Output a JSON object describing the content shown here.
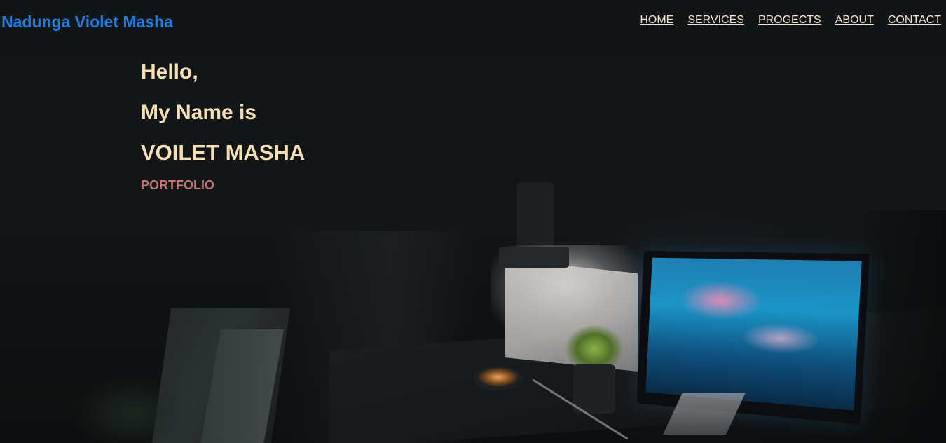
{
  "header": {
    "brand": "Nadunga Violet Masha",
    "nav": [
      {
        "label": "HOME"
      },
      {
        "label": "SERVICES"
      },
      {
        "label": "PROGECTS"
      },
      {
        "label": "ABOUT"
      },
      {
        "label": "CONTACT"
      }
    ]
  },
  "hero": {
    "greeting": "Hello,",
    "intro": "My Name is",
    "name": "VOILET MASHA",
    "tagline": "PORTFOLIO"
  },
  "colors": {
    "brand": "#1e7fe0",
    "nav_text": "#f3e3d5",
    "hero_text": "#f7dfb4",
    "tagline": "#c27478",
    "background": "#111415"
  }
}
